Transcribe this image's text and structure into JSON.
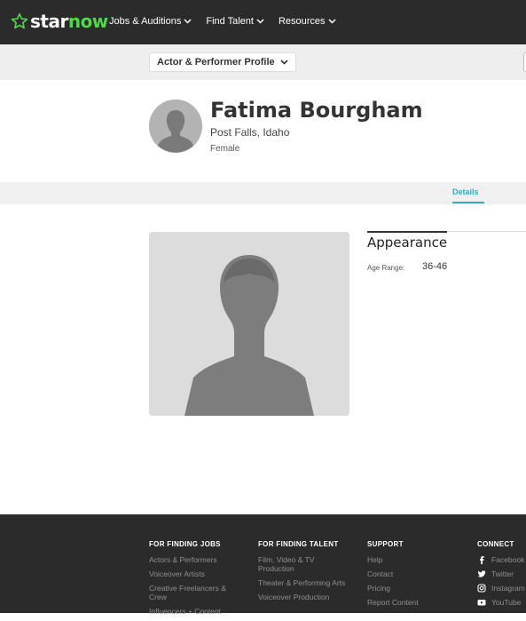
{
  "brand": {
    "wordmark_a": "star",
    "wordmark_b": "now",
    "star_color": "#52d64a"
  },
  "nav": {
    "items": [
      {
        "label": "Jobs & Auditions"
      },
      {
        "label": "Find Talent"
      },
      {
        "label": "Resources"
      }
    ]
  },
  "subnav": {
    "profile_select": "Actor & Performer Profile"
  },
  "profile": {
    "name": "Fatima Bourgham",
    "location": "Post Falls, Idaho",
    "gender": "Female"
  },
  "tabs": {
    "details": "Details",
    "accent": "#3aa6c6"
  },
  "appearance": {
    "title": "Appearance",
    "age_label": "Age Range:",
    "age_value": "36-46"
  },
  "footer": {
    "finding_jobs": {
      "heading": "FOR FINDING JOBS",
      "links": [
        "Actors & Performers",
        "Voiceover Artists",
        "Creative Freelancers & Crew",
        "Influencers + Content"
      ]
    },
    "finding_talent": {
      "heading": "FOR FINDING TALENT",
      "links": [
        "Film, Video & TV Production",
        "Theater & Performing Arts",
        "Voiceover Production"
      ]
    },
    "support": {
      "heading": "SUPPORT",
      "links": [
        "Help",
        "Contact",
        "Pricing",
        "Report Content"
      ]
    },
    "connect": {
      "heading": "CONNECT",
      "links": [
        {
          "label": "Facebook",
          "icon": "facebook-icon"
        },
        {
          "label": "Twitter",
          "icon": "twitter-icon"
        },
        {
          "label": "Instagram",
          "icon": "instagram-icon"
        },
        {
          "label": "YouTube",
          "icon": "youtube-icon"
        }
      ]
    }
  }
}
